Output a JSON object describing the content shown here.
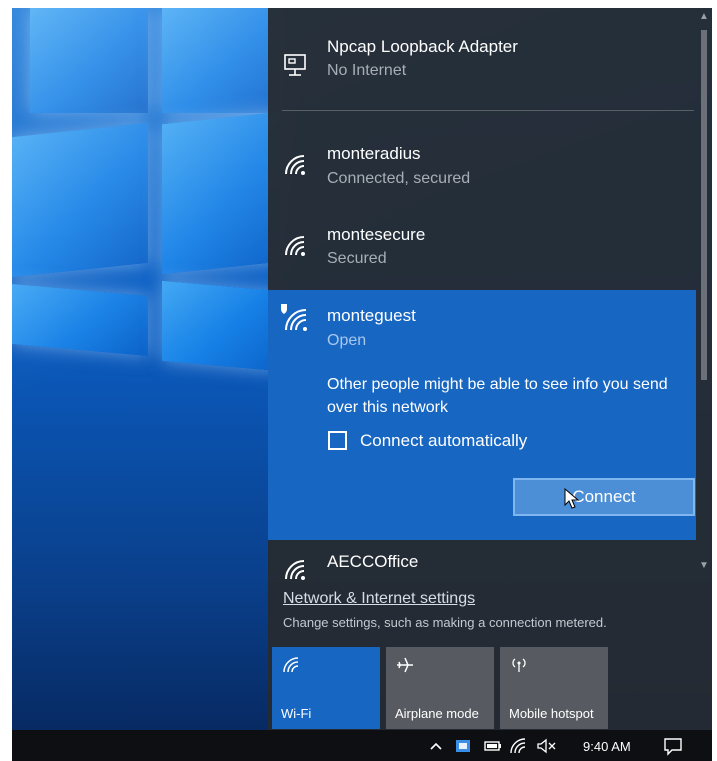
{
  "networks": [
    {
      "name": "Npcap Loopback Adapter",
      "status": "No Internet",
      "icon": "ethernet-icon"
    },
    {
      "name": "monteradius",
      "status": "Connected, secured",
      "icon": "wifi-icon"
    },
    {
      "name": "montesecure",
      "status": "Secured",
      "icon": "wifi-icon"
    },
    {
      "name": "monteguest",
      "status": "Open",
      "icon": "wifi-shield-icon"
    },
    {
      "name": "AECCOffice",
      "status": "",
      "icon": "wifi-icon"
    }
  ],
  "selected": {
    "warning": "Other people might be able to see info you send over this network",
    "auto_connect_label": "Connect automatically",
    "auto_connect_checked": false,
    "connect_label": "Connect"
  },
  "settings": {
    "link": "Network & Internet settings",
    "description": "Change settings, such as making a connection metered."
  },
  "quick_actions": [
    {
      "label": "Wi-Fi",
      "active": true,
      "icon": "wifi-icon"
    },
    {
      "label": "Airplane mode",
      "active": false,
      "icon": "airplane-icon"
    },
    {
      "label": "Mobile hotspot",
      "active": false,
      "icon": "hotspot-icon"
    }
  ],
  "taskbar": {
    "time": "9:40 AM",
    "icons": [
      "chevron-up-icon",
      "defender-icon",
      "battery-icon",
      "wifi-icon",
      "volume-muted-icon",
      "action-center-icon"
    ]
  },
  "colors": {
    "flyout_bg": "#262a30",
    "selected_bg": "#1766c2",
    "tile_active": "#1766c2",
    "tile_inactive": "#575b61",
    "desktop_blue": "#0b5cc0"
  }
}
